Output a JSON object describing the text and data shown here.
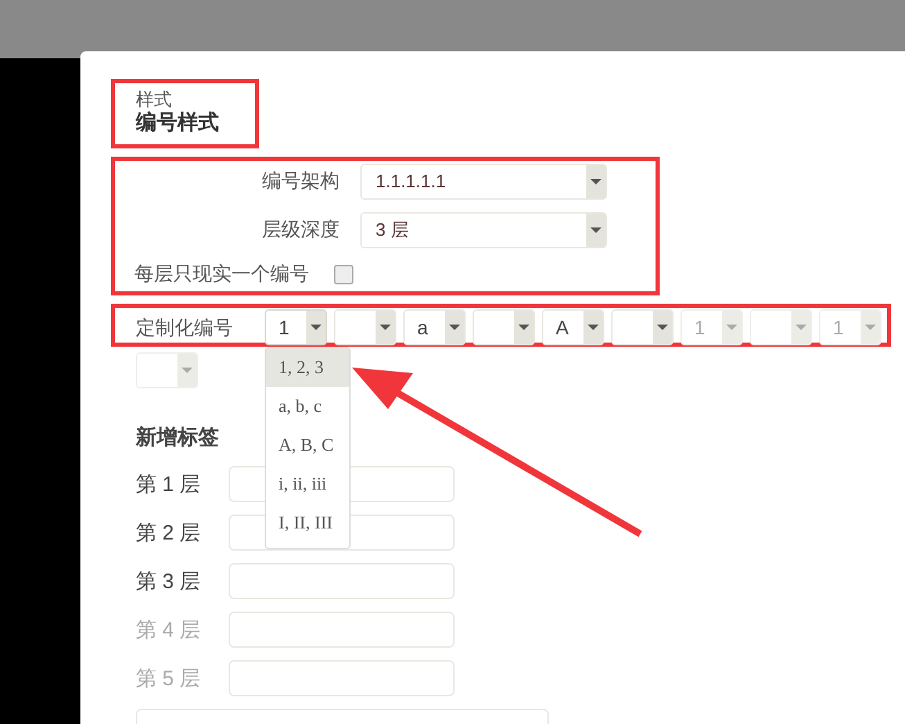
{
  "header": {
    "subtitle": "样式",
    "title": "编号样式"
  },
  "fields": [
    {
      "kind": "select",
      "label": "编号架构",
      "value": "1.1.1.1.1"
    },
    {
      "kind": "select",
      "label": "层级深度",
      "value": "3 层"
    },
    {
      "kind": "checkbox",
      "label": "每层只现实一个编号",
      "checked": false
    }
  ],
  "custom": {
    "label": "定制化编号",
    "selects": [
      {
        "value": "1",
        "disabled": false,
        "open": true
      },
      {
        "disabled": false,
        "open": false
      },
      {
        "value": "a",
        "disabled": false,
        "open": false
      },
      {
        "disabled": false,
        "open": false
      },
      {
        "value": "A",
        "disabled": false,
        "open": false
      },
      {
        "disabled": false,
        "open": false
      },
      {
        "value": "1",
        "disabled": true,
        "open": false
      },
      {
        "disabled": true,
        "open": false
      },
      {
        "value": "1",
        "disabled": true,
        "open": false
      },
      {
        "disabled": true,
        "open": false
      }
    ]
  },
  "dropdown": {
    "options": [
      {
        "label": "1, 2, 3",
        "selected": true
      },
      {
        "label": "a, b, c",
        "selected": false
      },
      {
        "label": "A, B, C",
        "selected": false
      },
      {
        "label": "i, ii, iii",
        "selected": false
      },
      {
        "label": "I, II, III",
        "selected": false
      }
    ]
  },
  "tags": {
    "title": "新增标签",
    "levels": [
      {
        "label": "第 1 层",
        "disabled": false
      },
      {
        "label": "第 2 层",
        "disabled": false
      },
      {
        "label": "第 3 层",
        "disabled": false
      },
      {
        "label": "第 4 层",
        "disabled": true
      },
      {
        "label": "第 5 层",
        "disabled": true
      }
    ]
  }
}
